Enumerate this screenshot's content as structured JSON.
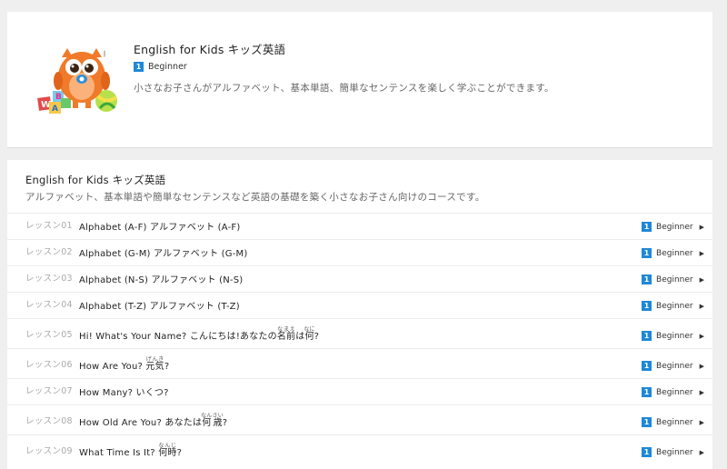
{
  "course": {
    "title": "English for Kids キッズ英語",
    "level_number": "1",
    "level_label": "Beginner",
    "description": "小さなお子さんがアルファベット、基本単語、簡単なセンテンスを楽しく学ぶことができます。"
  },
  "lesson_list": {
    "title": "English for Kids キッズ英語",
    "description": "アルファベット、基本単語や簡単なセンテンスなど英語の基礎を築く小さなお子さん向けのコースです。",
    "lessons": [
      {
        "number": "レッスン01",
        "title": "Alphabet (A-F) アルファベット (A-F)",
        "level_number": "1",
        "level": "Beginner"
      },
      {
        "number": "レッスン02",
        "title": "Alphabet (G-M) アルファベット (G-M)",
        "level_number": "1",
        "level": "Beginner"
      },
      {
        "number": "レッスン03",
        "title": "Alphabet (N-S) アルファベット (N-S)",
        "level_number": "1",
        "level": "Beginner"
      },
      {
        "number": "レッスン04",
        "title": "Alphabet (T-Z) アルファベット (T-Z)",
        "level_number": "1",
        "level": "Beginner"
      },
      {
        "number": "レッスン05",
        "title_en": "Hi! What's Your Name?",
        "title_ja_a": "こんにちは!あなたの",
        "ruby_1": "名前",
        "ruby_1_rt": "なまえ",
        "title_ja_b": "は",
        "ruby_2": "何",
        "ruby_2_rt": "なに",
        "title_ja_c": "?",
        "level_number": "1",
        "level": "Beginner"
      },
      {
        "number": "レッスン06",
        "title_en": "How Are You?",
        "ruby_1": "元気",
        "ruby_1_rt": "げんき",
        "title_ja_c": "?",
        "level_number": "1",
        "level": "Beginner"
      },
      {
        "number": "レッスン07",
        "title": "How Many? いくつ?",
        "level_number": "1",
        "level": "Beginner"
      },
      {
        "number": "レッスン08",
        "title_en": "How Old Are You?",
        "title_ja_a": "あなたは",
        "ruby_1": "何歳",
        "ruby_1_rt": "なんさい",
        "title_ja_c": "?",
        "level_number": "1",
        "level": "Beginner"
      },
      {
        "number": "レッスン09",
        "title_en": "What Time Is It?",
        "ruby_1": "何時",
        "ruby_1_rt": "なんじ",
        "title_ja_c": "?",
        "level_number": "1",
        "level": "Beginner"
      }
    ]
  },
  "icons": {
    "mascot": "owl-mascot-with-blocks-illustration",
    "chevron": "chevron-right-icon"
  },
  "colors": {
    "accent": "#1e88d8",
    "mascot_orange": "#f07a2a"
  }
}
